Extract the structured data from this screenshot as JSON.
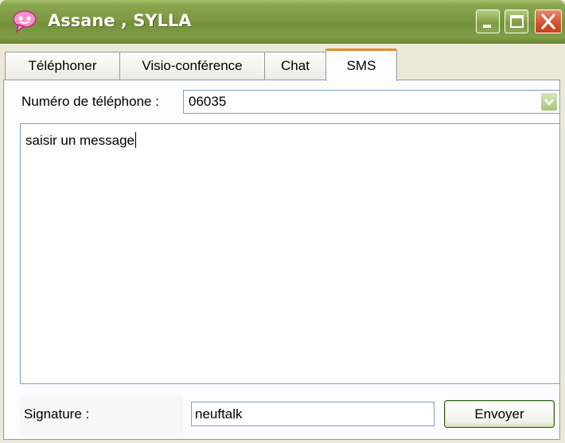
{
  "window": {
    "title": "Assane , SYLLA",
    "accent": "#7d9a42",
    "controls": {
      "minimize_icon": "minimize-icon",
      "maximize_icon": "maximize-icon",
      "close_icon": "close-icon"
    }
  },
  "tabs": [
    {
      "label": "Téléphoner",
      "active": false
    },
    {
      "label": "Visio-conférence",
      "active": false
    },
    {
      "label": "Chat",
      "active": false
    },
    {
      "label": "SMS",
      "active": true
    }
  ],
  "form": {
    "phone_label": "Numéro de téléphone :",
    "phone_value": "06035",
    "message_value": "saisir un message",
    "signature_label": "Signature :",
    "signature_value": "neuftalk",
    "send_label": "Envoyer"
  }
}
